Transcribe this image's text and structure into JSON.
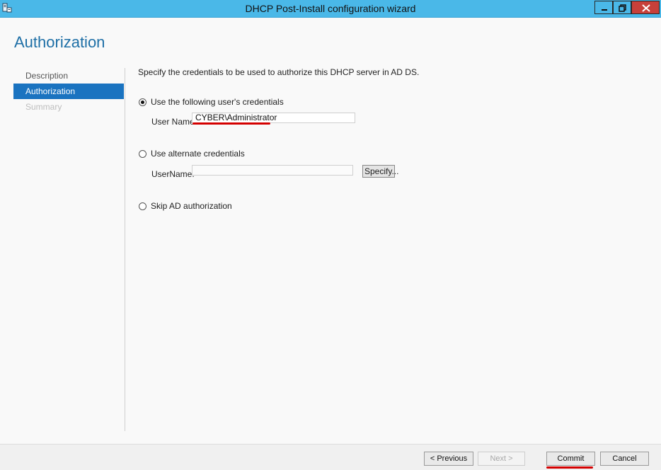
{
  "window": {
    "title": "DHCP Post-Install configuration wizard",
    "icon": "server-app-icon",
    "controls": [
      "minimize-icon",
      "restore-icon",
      "close-icon"
    ]
  },
  "page": {
    "heading": "Authorization"
  },
  "nav": {
    "items": [
      {
        "label": "Description",
        "state": "normal"
      },
      {
        "label": "Authorization",
        "state": "active"
      },
      {
        "label": "Summary",
        "state": "disabled"
      }
    ]
  },
  "content": {
    "intro": "Specify the credentials to be used to authorize this DHCP server in AD DS.",
    "option_user": {
      "label": "Use the following user's credentials",
      "checked": true,
      "field_label": "User Name:",
      "field_value": "CYBER\\Administrator"
    },
    "option_alternate": {
      "label": "Use alternate credentials",
      "checked": false,
      "field_label": "UserName:",
      "field_value": "",
      "specify_label": "Specify..."
    },
    "option_skip": {
      "label": "Skip AD authorization",
      "checked": false
    }
  },
  "footer": {
    "previous_label": "< Previous",
    "next_label": "Next >",
    "commit_label": "Commit",
    "cancel_label": "Cancel"
  },
  "colors": {
    "titlebar": "#4ab8e8",
    "heading": "#1e6fa6",
    "nav_active": "#1a73c0",
    "close_button": "#c7403a",
    "annotation_underline": "#d40000"
  }
}
